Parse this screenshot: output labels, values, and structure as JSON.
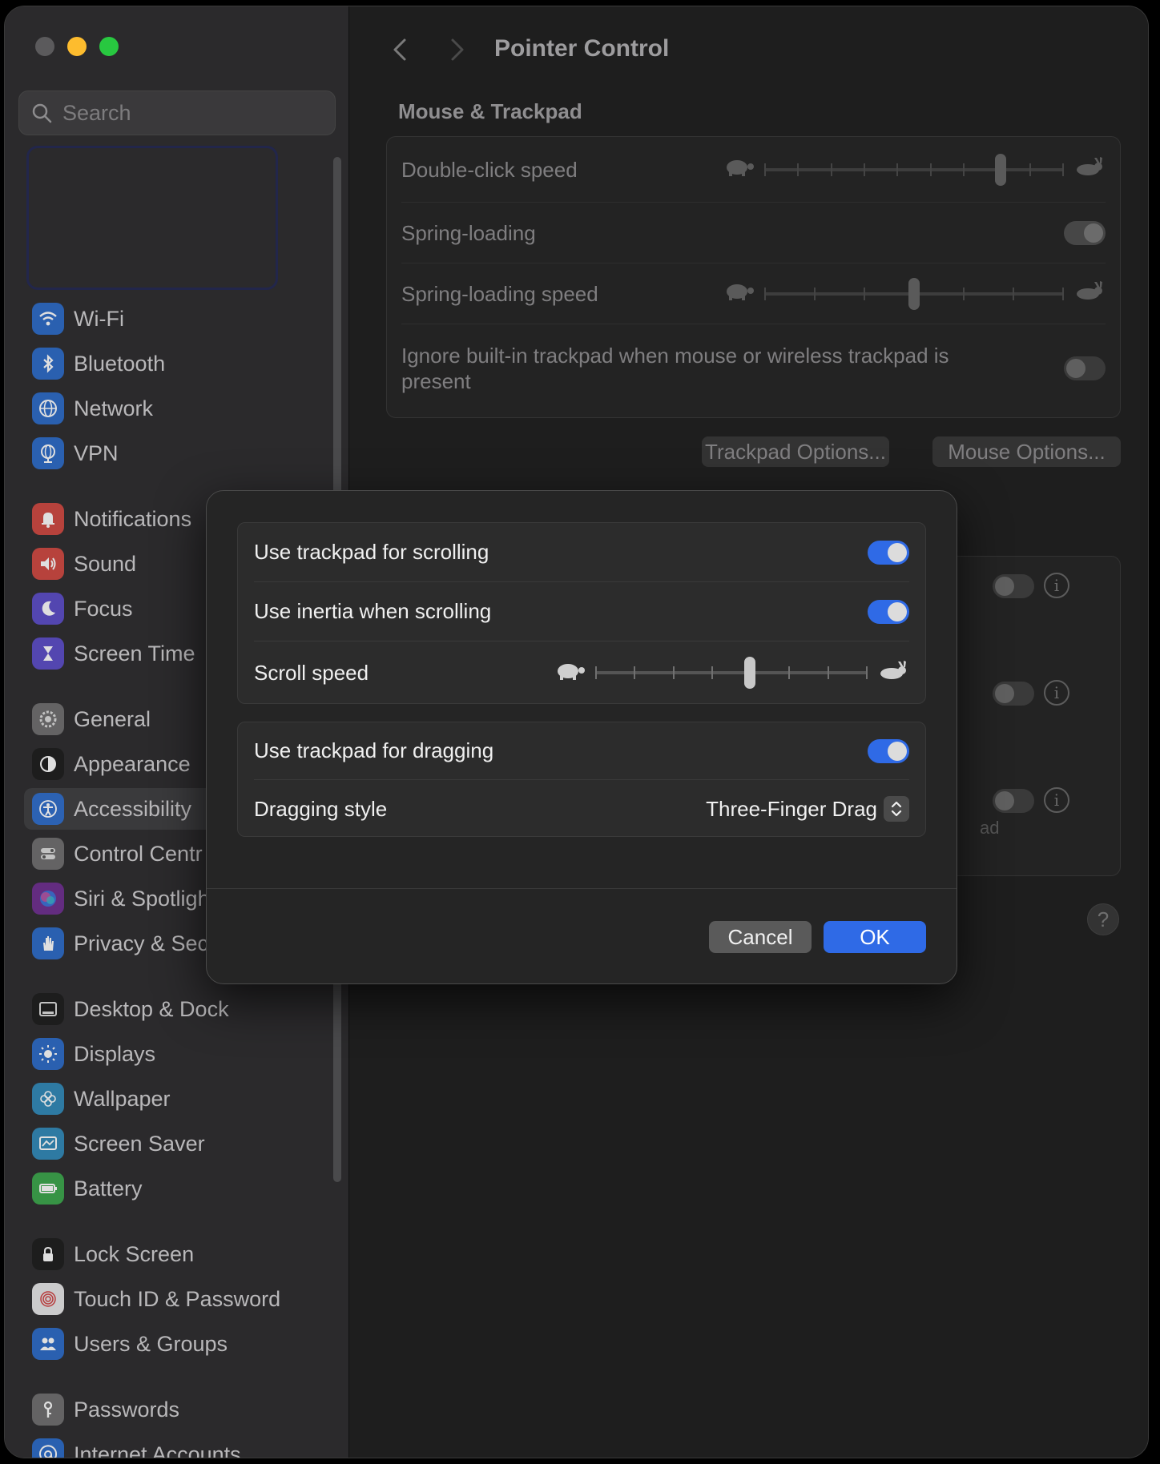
{
  "window": {
    "title": "Pointer Control"
  },
  "search": {
    "placeholder": "Search"
  },
  "sidebar": {
    "items": [
      {
        "label": "Wi-Fi",
        "icon": "wifi-icon",
        "color": "#2a6ac8"
      },
      {
        "label": "Bluetooth",
        "icon": "bluetooth-icon",
        "color": "#2a6ac8"
      },
      {
        "label": "Network",
        "icon": "globe-icon",
        "color": "#2a6ac8"
      },
      {
        "label": "VPN",
        "icon": "vpn-globe-icon",
        "color": "#2a6ac8"
      },
      {
        "label": "Notifications",
        "icon": "bell-icon",
        "color": "#d0473f"
      },
      {
        "label": "Sound",
        "icon": "speaker-icon",
        "color": "#d0473f"
      },
      {
        "label": "Focus",
        "icon": "moon-icon",
        "color": "#5b4bc8"
      },
      {
        "label": "Screen Time",
        "icon": "hourglass-icon",
        "color": "#5b4bc8"
      },
      {
        "label": "General",
        "icon": "gear-icon",
        "color": "#6e6e6e"
      },
      {
        "label": "Appearance",
        "icon": "appearance-icon",
        "color": "#1b1b1b"
      },
      {
        "label": "Accessibility",
        "icon": "accessibility-icon",
        "color": "#2a6ac8"
      },
      {
        "label": "Control Centr",
        "icon": "toggles-icon",
        "color": "#6e6e6e"
      },
      {
        "label": "Siri & Spotligh",
        "icon": "siri-icon",
        "color": "#6d2d8f"
      },
      {
        "label": "Privacy & Sec",
        "icon": "hand-icon",
        "color": "#2a6ac8"
      },
      {
        "label": "Desktop & Dock",
        "icon": "dock-icon",
        "color": "#1b1b1b"
      },
      {
        "label": "Displays",
        "icon": "sun-icon",
        "color": "#2a6ac8"
      },
      {
        "label": "Wallpaper",
        "icon": "flower-icon",
        "color": "#2f89b8"
      },
      {
        "label": "Screen Saver",
        "icon": "screensaver-icon",
        "color": "#2f89b8"
      },
      {
        "label": "Battery",
        "icon": "battery-icon",
        "color": "#3aa64a"
      },
      {
        "label": "Lock Screen",
        "icon": "lock-icon",
        "color": "#1b1b1b"
      },
      {
        "label": "Touch ID & Password",
        "icon": "fingerprint-icon",
        "color": "#e8e8e8"
      },
      {
        "label": "Users & Groups",
        "icon": "users-icon",
        "color": "#2a6ac8"
      },
      {
        "label": "Passwords",
        "icon": "key-icon",
        "color": "#6e6e6e"
      },
      {
        "label": "Internet Accounts",
        "icon": "at-icon",
        "color": "#2a6ac8"
      }
    ],
    "selected": "Accessibility"
  },
  "main": {
    "section": "Mouse & Trackpad",
    "rows": {
      "double_click": "Double-click speed",
      "spring_loading": "Spring-loading",
      "spring_speed": "Spring-loading speed",
      "ignore_trackpad": "Ignore built-in trackpad when mouse or wireless trackpad is present"
    },
    "double_click_value": 0.8,
    "spring_speed_value": 0.5,
    "buttons": {
      "trackpad_options": "Trackpad Options...",
      "mouse_options": "Mouse Options..."
    },
    "partial_text": "ad",
    "help": "?"
  },
  "dialog": {
    "rows": {
      "scrolling": "Use trackpad for scrolling",
      "inertia": "Use inertia when scrolling",
      "scroll_speed": "Scroll speed",
      "dragging": "Use trackpad for dragging",
      "dragging_style": "Dragging style"
    },
    "scroll_speed_value": 0.57,
    "dragging_style_value": "Three-Finger Drag",
    "buttons": {
      "cancel": "Cancel",
      "ok": "OK"
    },
    "colors": {
      "accent": "#2f6ae6"
    }
  }
}
